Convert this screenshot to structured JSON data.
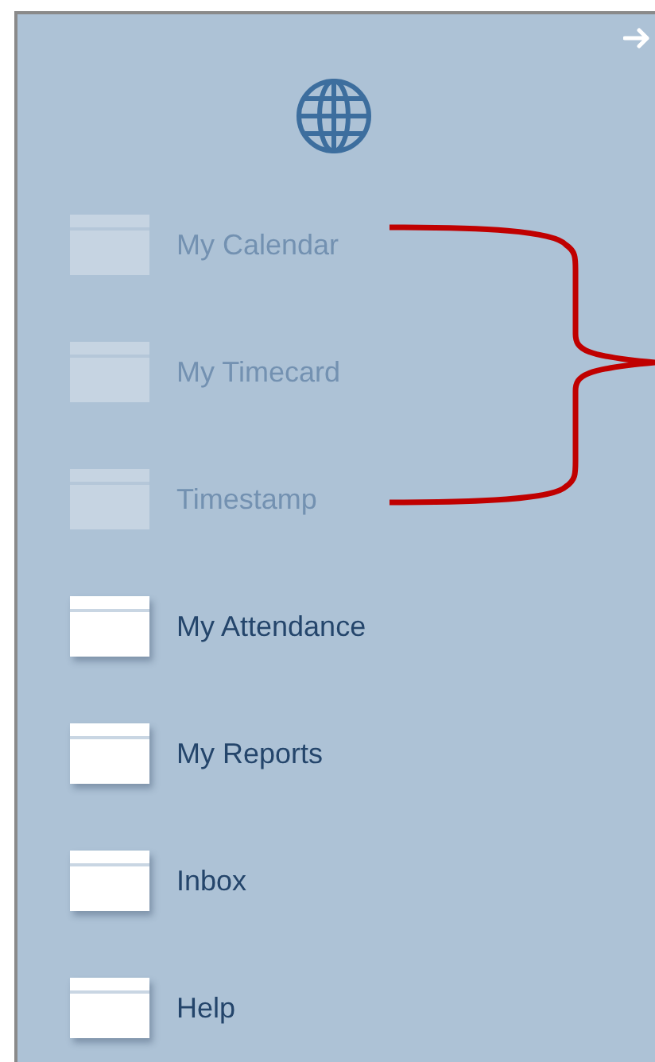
{
  "menu": {
    "items": [
      {
        "label": "My Calendar",
        "disabled": true
      },
      {
        "label": "My Timecard",
        "disabled": true
      },
      {
        "label": "Timestamp",
        "disabled": true
      },
      {
        "label": "My Attendance",
        "disabled": false
      },
      {
        "label": "My Reports",
        "disabled": false
      },
      {
        "label": "Inbox",
        "disabled": false
      },
      {
        "label": "Help",
        "disabled": false
      }
    ]
  }
}
